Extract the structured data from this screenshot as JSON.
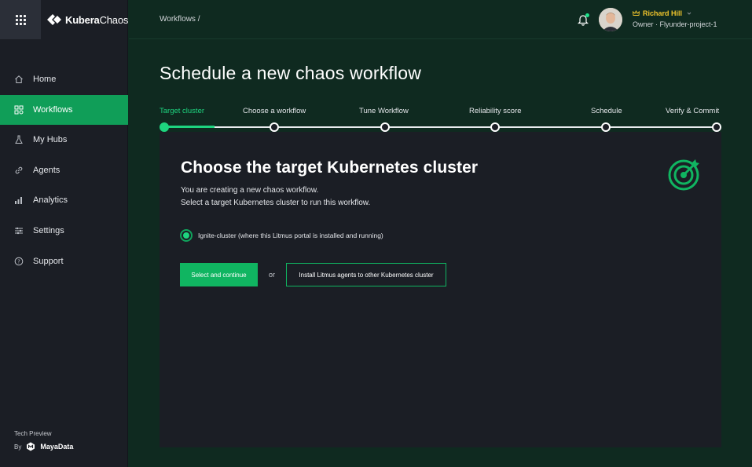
{
  "brand": {
    "name_bold": "Kubera",
    "name_light": "Chaos"
  },
  "sidebar": {
    "items": [
      {
        "label": "Home",
        "icon": "home-icon",
        "active": false
      },
      {
        "label": "Workflows",
        "icon": "workflows-icon",
        "active": true
      },
      {
        "label": "My Hubs",
        "icon": "flask-icon",
        "active": false
      },
      {
        "label": "Agents",
        "icon": "link-icon",
        "active": false
      },
      {
        "label": "Analytics",
        "icon": "analytics-icon",
        "active": false
      },
      {
        "label": "Settings",
        "icon": "settings-sliders-icon",
        "active": false
      },
      {
        "label": "Support",
        "icon": "support-icon",
        "active": false
      }
    ],
    "footer": {
      "tech_preview": "Tech Preview",
      "by": "By",
      "company": "MayaData"
    }
  },
  "header": {
    "breadcrumb": "Workflows   /",
    "user": {
      "name": "Richard Hill",
      "role": "Owner · Flyunder-project-1"
    }
  },
  "page": {
    "title": "Schedule a new chaos workflow"
  },
  "stepper": {
    "steps": [
      {
        "label": "Target cluster",
        "active": true
      },
      {
        "label": "Choose a workflow",
        "active": false
      },
      {
        "label": "Tune Workflow",
        "active": false
      },
      {
        "label": "Reliability score",
        "active": false
      },
      {
        "label": "Schedule",
        "active": false
      },
      {
        "label": "Verify & Commit",
        "active": false
      }
    ]
  },
  "card": {
    "title": "Choose the target Kubernetes cluster",
    "subtitle_1": "You are creating a new chaos workflow.",
    "subtitle_2": "Select a target Kubernetes cluster to run this workflow.",
    "radio_label": "Ignite-cluster (where this Litmus portal is installed and running)",
    "primary_button": "Select and continue",
    "or": "or",
    "secondary_button": "Install Litmus agents to other Kubernetes cluster"
  },
  "colors": {
    "accent": "#1ed47f",
    "primary_button": "#10b561",
    "user_name": "#f2c62c",
    "sidebar_bg": "#1b1e25",
    "page_bg": "#0f2a20"
  }
}
